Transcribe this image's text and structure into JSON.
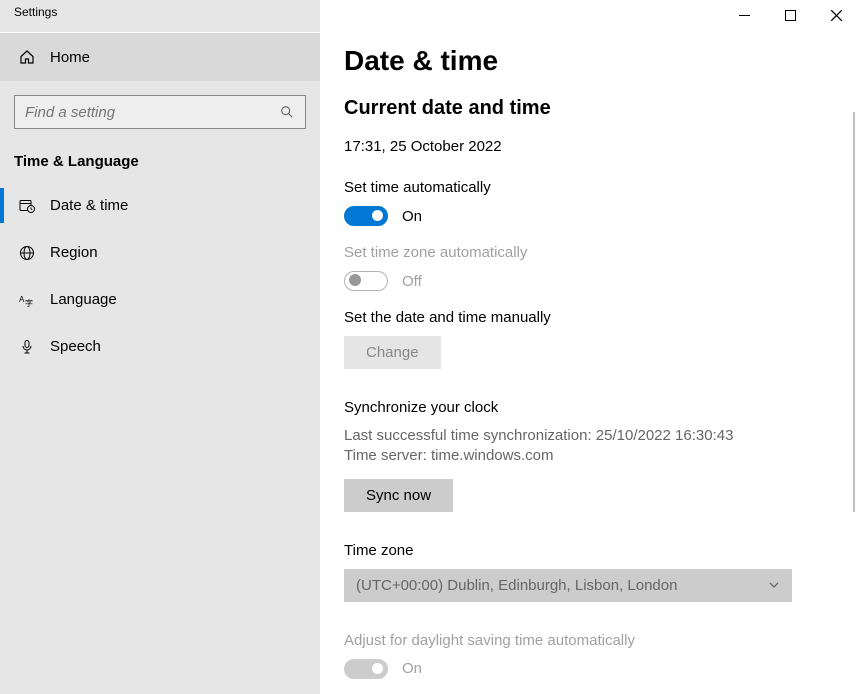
{
  "window": {
    "title": "Settings"
  },
  "sidebar": {
    "home_label": "Home",
    "search_placeholder": "Find a setting",
    "section_heading": "Time & Language",
    "items": [
      {
        "name": "date-time",
        "label": "Date & time",
        "selected": true
      },
      {
        "name": "region",
        "label": "Region"
      },
      {
        "name": "language",
        "label": "Language"
      },
      {
        "name": "speech",
        "label": "Speech"
      }
    ]
  },
  "page": {
    "title": "Date & time",
    "current_heading": "Current date and time",
    "current_value": "17:31, 25 October 2022",
    "set_time_auto": {
      "label": "Set time automatically",
      "on": true,
      "text": "On"
    },
    "set_tz_auto": {
      "label": "Set time zone automatically",
      "on": false,
      "text": "Off",
      "disabled": true
    },
    "set_manual": {
      "label": "Set the date and time manually",
      "button": "Change",
      "disabled": true
    },
    "sync": {
      "heading": "Synchronize your clock",
      "last_line": "Last successful time synchronization: 25/10/2022 16:30:43",
      "server_line": "Time server: time.windows.com",
      "button": "Sync now"
    },
    "timezone": {
      "heading": "Time zone",
      "selected": "(UTC+00:00) Dublin, Edinburgh, Lisbon, London"
    },
    "dst": {
      "label": "Adjust for daylight saving time automatically",
      "on": true,
      "text": "On",
      "disabled": true
    }
  }
}
